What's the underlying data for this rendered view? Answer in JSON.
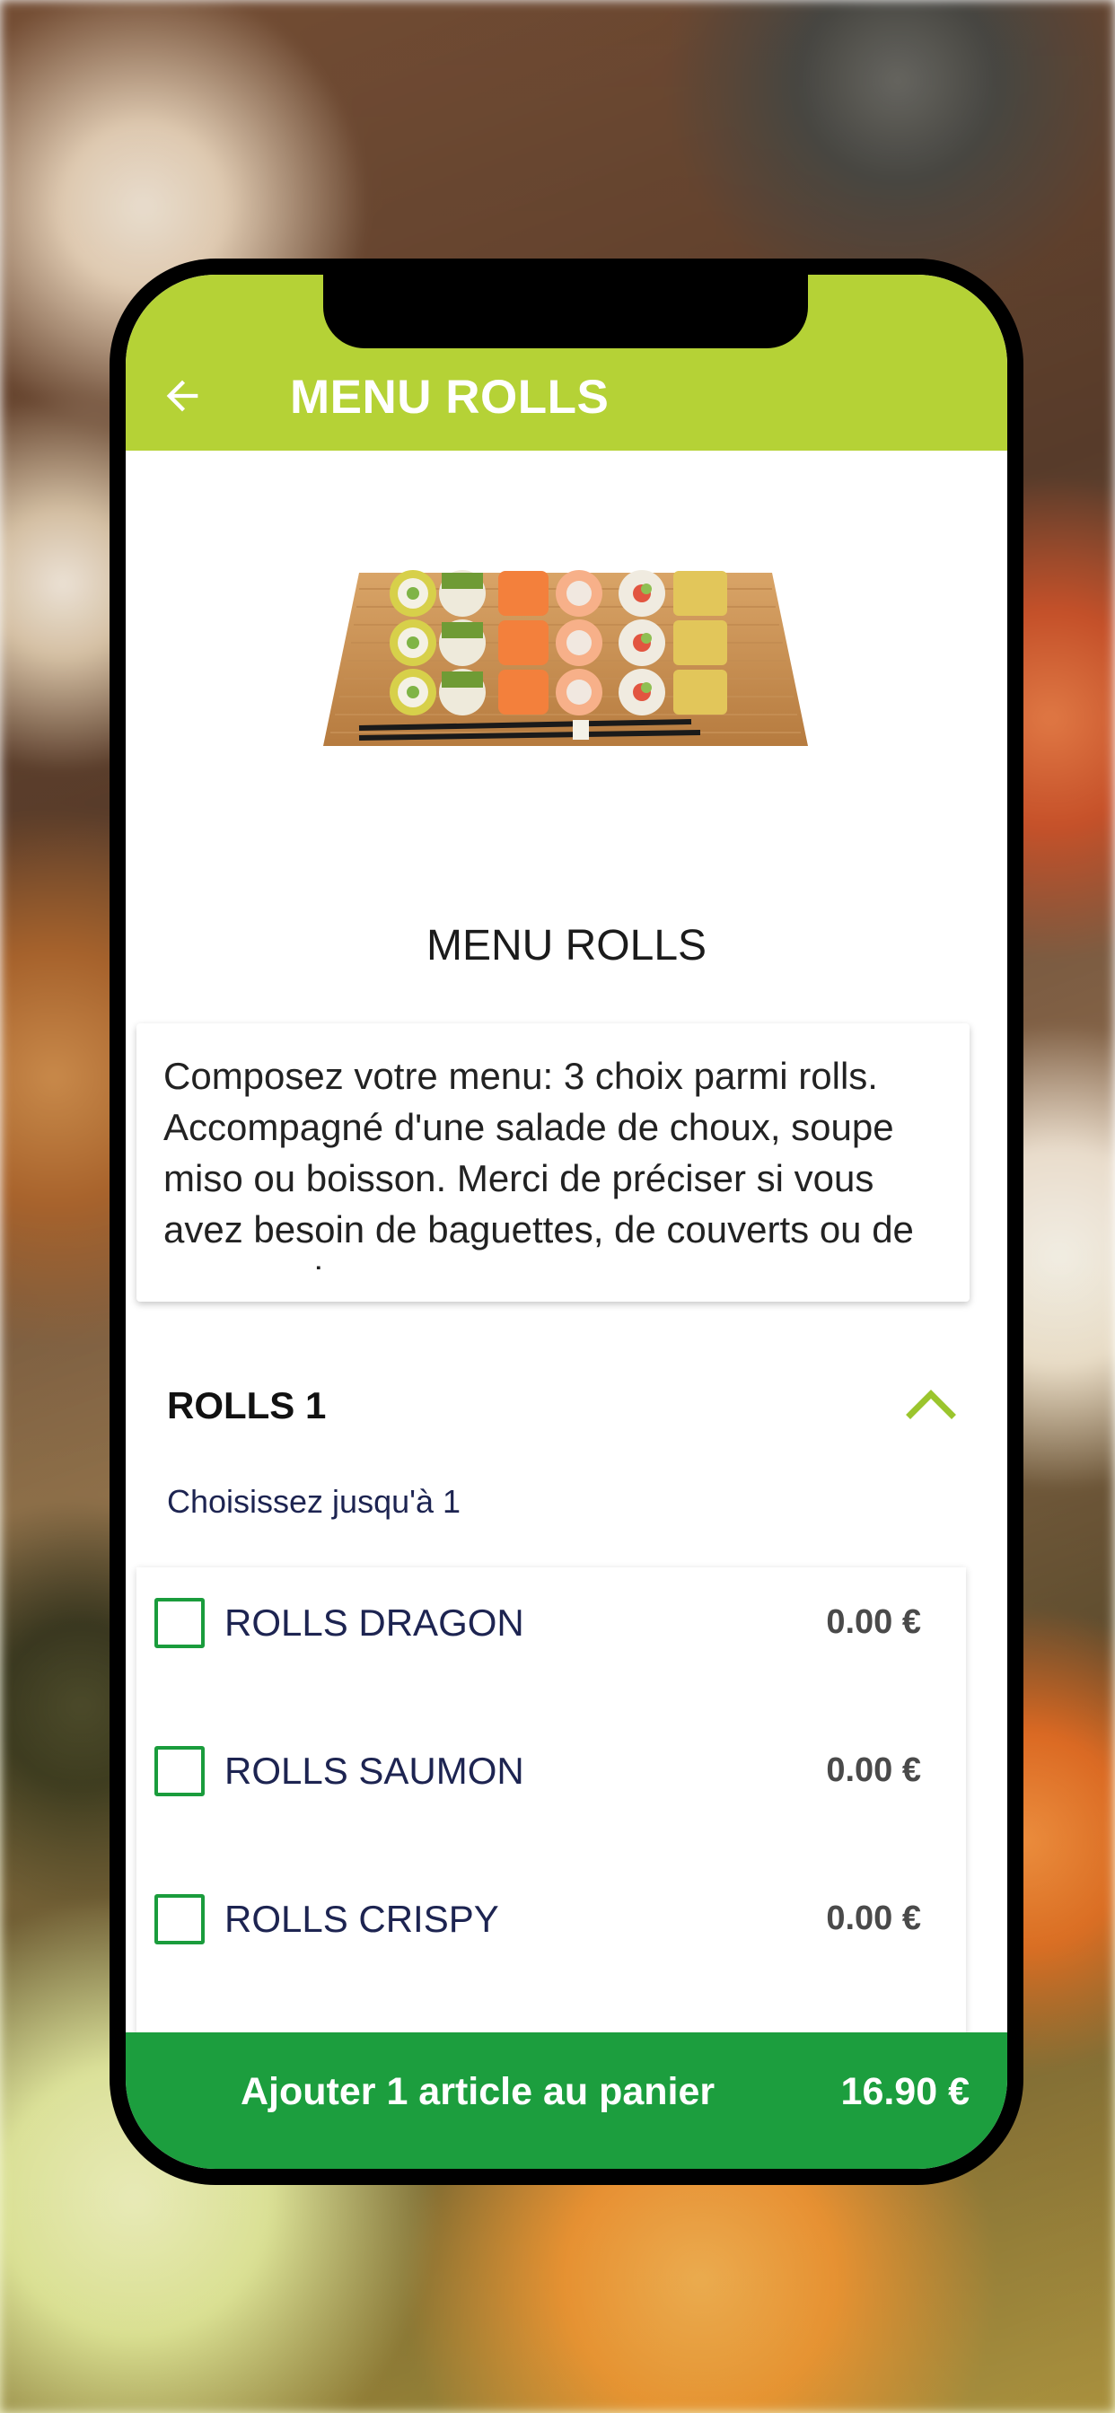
{
  "appbar": {
    "title": "MENU ROLLS",
    "back_icon": "arrow-left-icon"
  },
  "colors": {
    "accent": "#b5d236",
    "primary_green": "#1c9e3e",
    "checkbox_border": "#1a9c3c",
    "option_text": "#1d2451"
  },
  "product": {
    "image": "sushi-rolls-tray",
    "name": "MENU ROLLS",
    "description": "Composez votre menu: 3 choix parmi rolls. Accompagné d'une salade de choux, soupe miso ou boisson. Merci de préciser si vous avez besoin de baguettes, de couverts ou de sauce soja."
  },
  "section": {
    "title": "ROLLS 1",
    "subtitle": "Choisissez jusqu'à 1",
    "toggle_icon": "chevron-up-icon",
    "options": [
      {
        "label": "ROLLS DRAGON",
        "price": "0.00 €",
        "checked": false
      },
      {
        "label": "ROLLS SAUMON",
        "price": "0.00 €",
        "checked": false
      },
      {
        "label": "ROLLS CRISPY",
        "price": "0.00 €",
        "checked": false
      }
    ]
  },
  "cart": {
    "label": "Ajouter 1 article au panier",
    "price": "16.90 €"
  }
}
